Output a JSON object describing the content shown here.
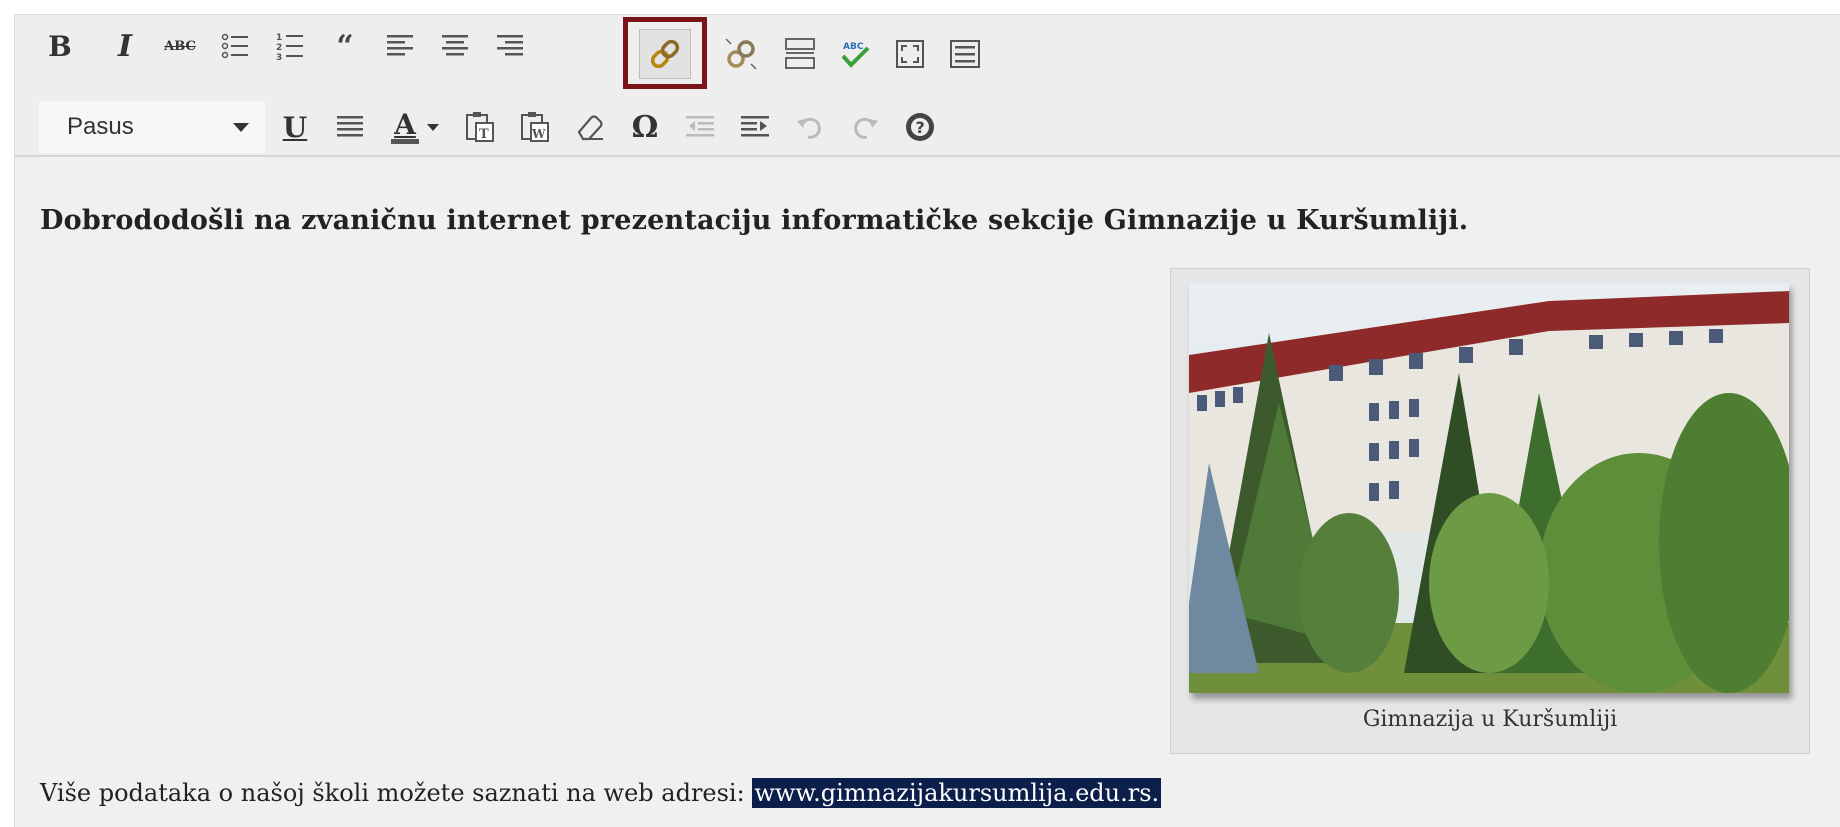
{
  "toolbar": {
    "row1": [
      {
        "name": "bold-button",
        "label": "B"
      },
      {
        "name": "italic-button",
        "label": "I"
      },
      {
        "name": "strikethrough-button",
        "label": "ABC"
      },
      {
        "name": "bullet-list-button",
        "icon": "bullet-list-icon"
      },
      {
        "name": "numbered-list-button",
        "icon": "numbered-list-icon"
      },
      {
        "name": "blockquote-button",
        "label": "66"
      },
      {
        "name": "align-left-button",
        "icon": "align-left-icon"
      },
      {
        "name": "align-center-button",
        "icon": "align-center-icon"
      },
      {
        "name": "align-right-button",
        "icon": "align-right-icon"
      },
      {
        "name": "insert-link-button",
        "icon": "link-icon",
        "state": "active"
      },
      {
        "name": "remove-link-button",
        "icon": "unlink-icon"
      },
      {
        "name": "insert-more-button",
        "icon": "read-more-icon"
      },
      {
        "name": "spellcheck-button",
        "label": "ABC",
        "icon": "spellcheck-icon"
      },
      {
        "name": "fullscreen-button",
        "icon": "fullscreen-icon"
      },
      {
        "name": "toolbar-toggle-button",
        "icon": "keyboard-icon"
      }
    ],
    "row2": [
      {
        "name": "underline-button",
        "label": "U"
      },
      {
        "name": "justify-button",
        "icon": "justify-icon"
      },
      {
        "name": "text-color-button",
        "label": "A"
      },
      {
        "name": "paste-text-button",
        "label": "T"
      },
      {
        "name": "paste-word-button",
        "label": "W"
      },
      {
        "name": "clear-formatting-button",
        "icon": "eraser-icon"
      },
      {
        "name": "special-character-button",
        "label": "Ω"
      },
      {
        "name": "outdent-button",
        "icon": "outdent-icon",
        "state": "disabled"
      },
      {
        "name": "indent-button",
        "icon": "indent-icon"
      },
      {
        "name": "undo-button",
        "icon": "undo-icon",
        "state": "disabled"
      },
      {
        "name": "redo-button",
        "icon": "redo-icon",
        "state": "disabled"
      },
      {
        "name": "help-button",
        "icon": "help-icon"
      }
    ],
    "format_select": {
      "value": "Pasus"
    },
    "highlight_color": "#7a1418"
  },
  "content": {
    "intro": "Dobrododošli na zvaničnu internet prezentaciju informatičke sekcije Gimnazije u Kuršumliji.",
    "figure": {
      "caption": "Gimnazija u Kuršumliji"
    },
    "more_text": "Više podataka o našoj školi možete saznati na web adresi: ",
    "url": "www.gimnazijakursumlija.edu.rs.",
    "selection_color": "#0b1f4a"
  }
}
